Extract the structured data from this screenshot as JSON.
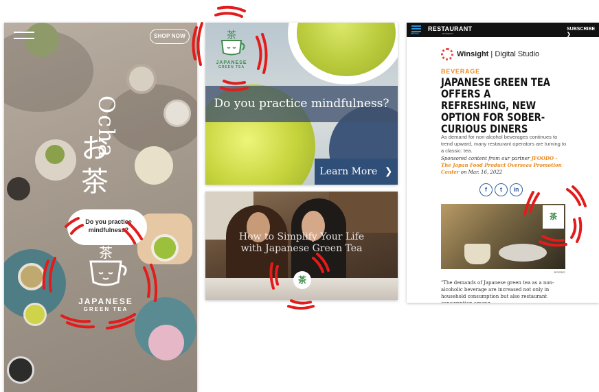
{
  "panel1": {
    "shop_now": "SHOP NOW",
    "ocha_latin": "Ocha",
    "ocha_kana": "お茶",
    "bubble_text": "Do you practice mindfulness?",
    "logo_kanji": "茶",
    "logo_line1": "JAPANESE",
    "logo_line2": "GREEN TEA"
  },
  "panel2": {
    "headline": "Do you practice mindfulness?",
    "learn_more": "Learn More",
    "chevron": "❯",
    "logo_kanji": "茶",
    "logo_line1": "JAPANESE",
    "logo_line2": "GREEN TEA"
  },
  "panel3": {
    "title": "How to Simplify Your Life with Japanese Green Tea",
    "badge_kanji": "茶"
  },
  "panel4": {
    "menu_label": "MENU",
    "brand": "RESTAURANT",
    "brand_sub": "BUSINESS",
    "subscribe": "SUBSCRIBE ❯",
    "winsight_bold": "Winsight",
    "winsight_rest": " | Digital Studio",
    "category": "BEVERAGE",
    "headline": "JAPANESE GREEN TEA OFFERS A REFRESHING, NEW OPTION FOR SOBER-CURIOUS DINERS",
    "dek": "As demand for non-alcohol beverages continues to trend upward, many restaurant operators are turning to a classic: tea.",
    "sponsor_prefix": "Sponsored content from our partner ",
    "sponsor_link": "JFOODO - The Japan Food Product Overseas Promotion Center",
    "sponsor_date": " on Mar. 16, 2022",
    "social": [
      "f",
      "t",
      "in"
    ],
    "photo_logo": "茶",
    "credit": "JFOODO",
    "body": "\"The demands of Japanese green tea as a non-alcoholic beverage are increased not only in household consumption but also restaurant consumption among"
  },
  "colors": {
    "accent_orange": "#e98a1f",
    "navy": "#2f4f78",
    "tea_green": "#3d8a4a",
    "highlight_red": "#e31b1b"
  }
}
